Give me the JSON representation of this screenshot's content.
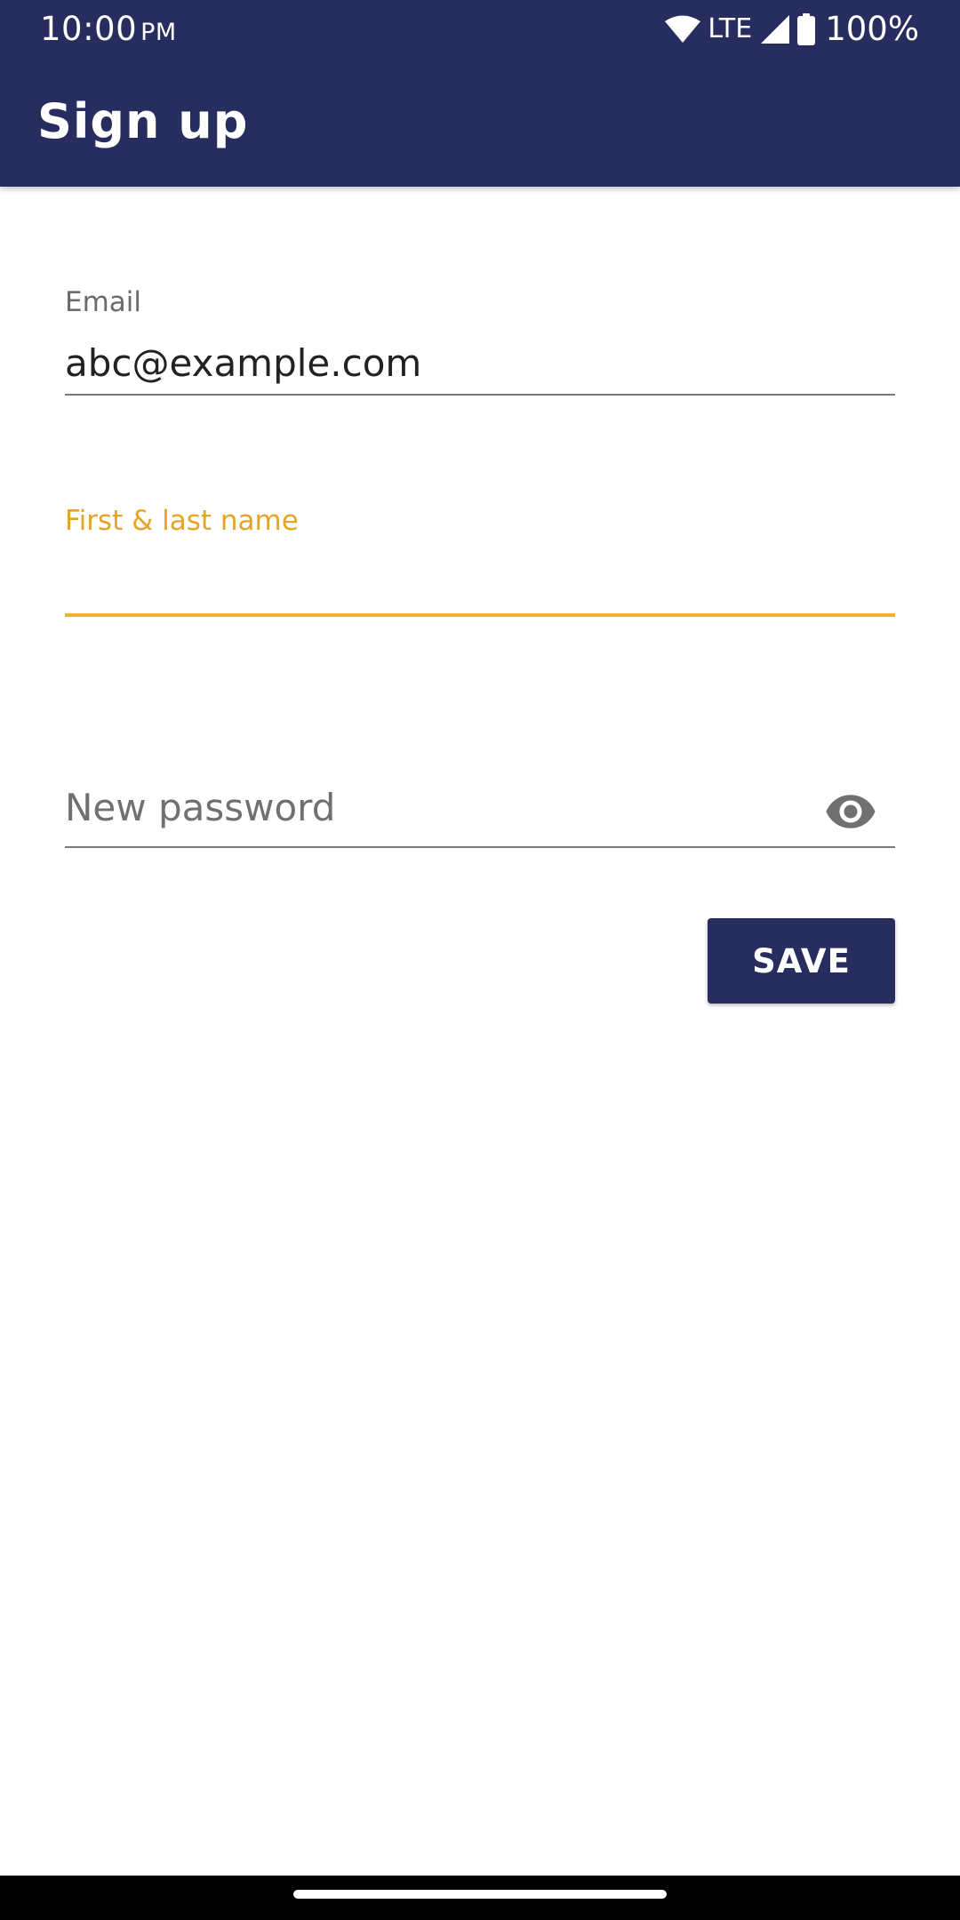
{
  "status_bar": {
    "time": "10:00",
    "ampm": "PM",
    "network": "LTE",
    "battery": "100%",
    "icons": [
      "wifi-icon",
      "cell-signal-icon",
      "battery-icon"
    ]
  },
  "app_bar": {
    "title": "Sign up"
  },
  "form": {
    "email": {
      "label": "Email",
      "value": "abc@example.com"
    },
    "name": {
      "label": "First & last name",
      "value": ""
    },
    "password": {
      "placeholder": "New password",
      "icon": "visibility-eye-icon"
    }
  },
  "actions": {
    "save_label": "SAVE"
  },
  "colors": {
    "primary": "#272d5e",
    "accent": "#efb22f",
    "focused_label": "#e5a524"
  }
}
